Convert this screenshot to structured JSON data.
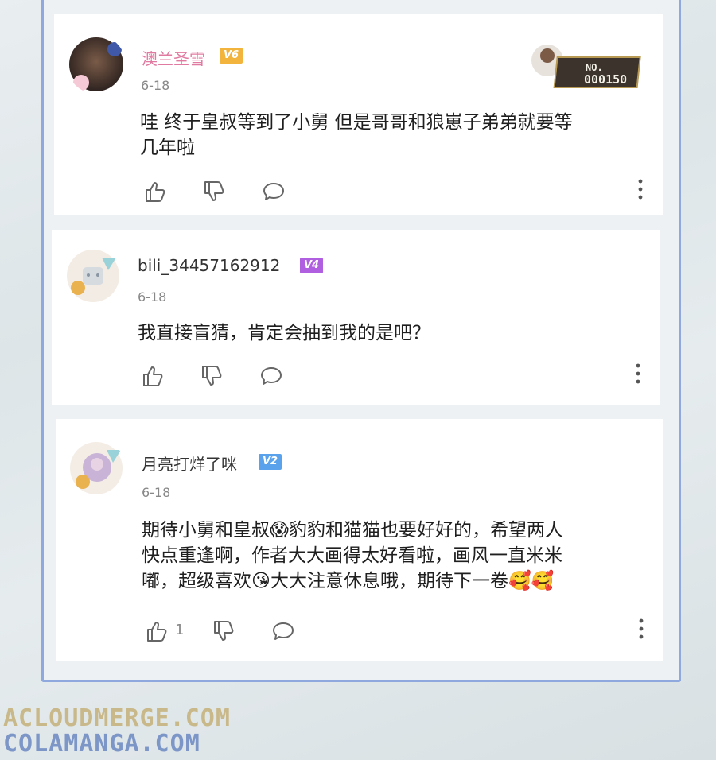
{
  "comments": [
    {
      "username": "澳兰圣雪",
      "level": "V6",
      "level_color": "#f2b43c",
      "date": "6-18",
      "content_lines": [
        "哇 终于皇叔等到了小舅 但是哥哥和狼崽子弟弟就要等",
        "几年啦"
      ],
      "medal_text": "NO.",
      "medal_number": "000150",
      "like_icon": "thumbs-up-icon",
      "dislike_icon": "thumbs-down-icon",
      "reply_icon": "speech-bubble-icon",
      "more_icon": "more-vertical-icon"
    },
    {
      "username": "bili_34457162912",
      "level": "V4",
      "level_color": "#b05fe0",
      "date": "6-18",
      "content_lines": [
        "我直接盲猜，肯定会抽到我的是吧？"
      ],
      "like_icon": "thumbs-up-icon",
      "dislike_icon": "thumbs-down-icon",
      "reply_icon": "speech-bubble-icon",
      "more_icon": "more-vertical-icon"
    },
    {
      "username": "月亮打烊了咪",
      "level": "V2",
      "level_color": "#5aa3ec",
      "date": "6-18",
      "content_lines": [
        "期待小舅和皇叔😱豹豹和猫猫也要好好的，希望两人",
        "快点重逢啊，作者大大画得太好看啦，画风一直米米",
        "嘟，超级喜欢😘大大注意休息哦，期待下一卷🥰🥰"
      ],
      "like_count": "1",
      "like_icon": "thumbs-up-icon",
      "dislike_icon": "thumbs-down-icon",
      "reply_icon": "speech-bubble-icon",
      "more_icon": "more-vertical-icon"
    }
  ],
  "watermarks": [
    "ACLOUDMERGE.COM",
    "COLAMANGA.COM"
  ]
}
